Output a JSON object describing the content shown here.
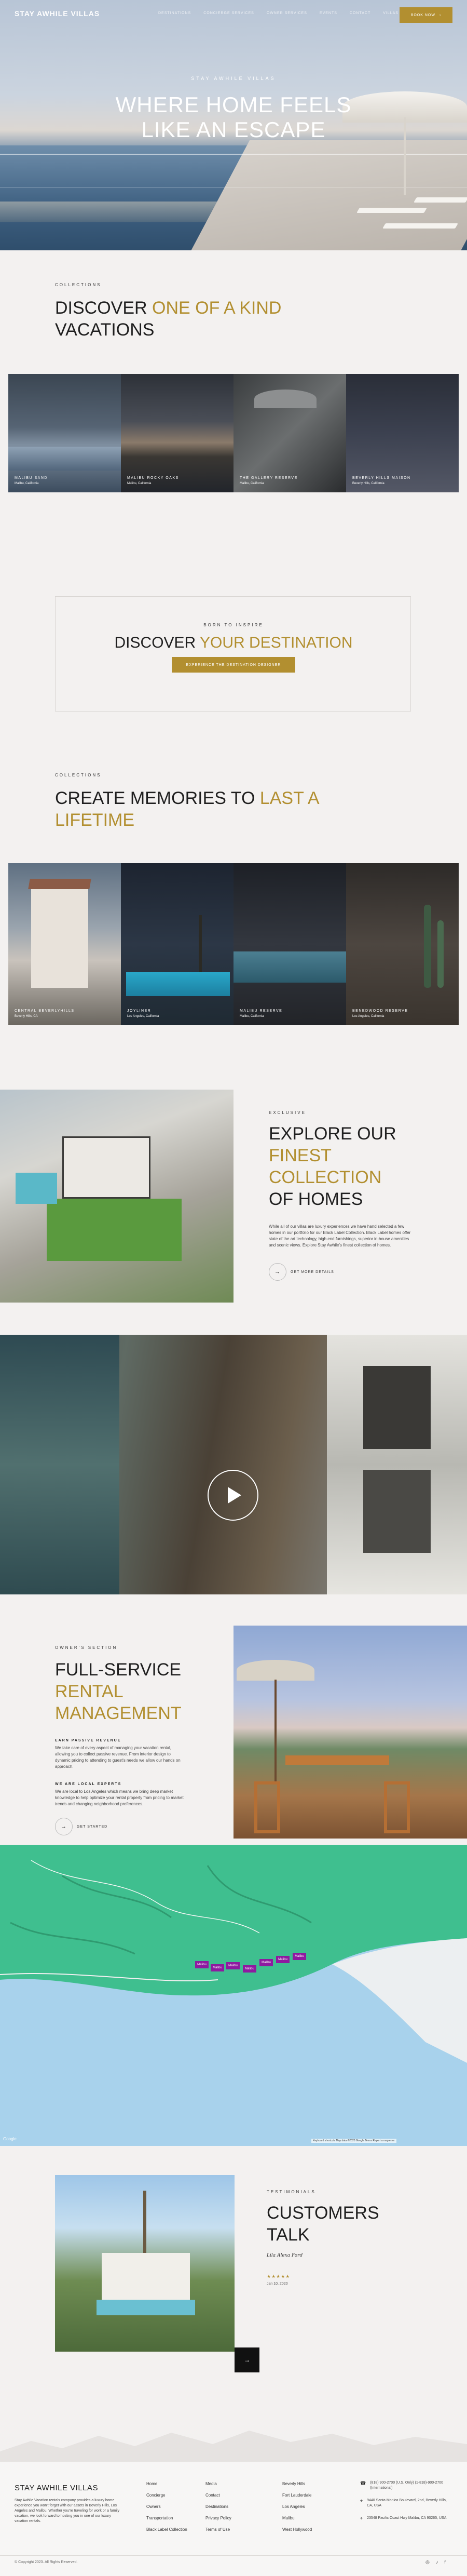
{
  "header": {
    "logo": "STAY AWHILE VILLAS",
    "nav": [
      "DESTINATIONS",
      "CONCIERGE SERVICES",
      "OWNER SERVICES",
      "EVENTS",
      "CONTACT",
      "VILLAS"
    ],
    "book_label": "BOOK NOW",
    "book_icon": "chevron-right-icon"
  },
  "hero": {
    "eyebrow": "STAY AWHILE VILLAS",
    "title_line1": "WHERE HOME FEELS",
    "title_line2": "LIKE AN ESCAPE"
  },
  "collections1": {
    "eyebrow": "COLLECTIONS",
    "title_plain1": "DISCOVER ",
    "title_gold": "ONE OF A KIND",
    "title_plain2": "VACATIONS",
    "cards": [
      {
        "name": "MALIBU SAND",
        "location": "Malibu, California"
      },
      {
        "name": "MALIBU ROCKY OAKS",
        "location": "Malibu, California"
      },
      {
        "name": "THE GALLERY RESERVE",
        "location": "Malibu, California"
      },
      {
        "name": "BEVERLY HILLS MAISON",
        "location": "Beverly Hills, California"
      }
    ]
  },
  "destination": {
    "eyebrow": "BORN TO INSPIRE",
    "title_plain": "DISCOVER ",
    "title_gold": "YOUR DESTINATION",
    "button": "EXPERIENCE THE DESTINATION DESIGNER"
  },
  "collections2": {
    "eyebrow": "COLLECTIONS",
    "title_plain": "CREATE MEMORIES TO ",
    "title_gold1": "LAST A",
    "title_gold2": "LIFETIME",
    "cards": [
      {
        "name": "CENTRAL BEVERLYHILLS",
        "location": "Beverly Hills, CA"
      },
      {
        "name": "JOYLINER",
        "location": "Los Angeles, California"
      },
      {
        "name": "MALIBU RESERVE",
        "location": "Malibu, California"
      },
      {
        "name": "BENEDWOOD RESERVE",
        "location": "Los Angeles, California"
      }
    ]
  },
  "exclusive": {
    "eyebrow": "EXCLUSIVE",
    "title_plain1": "EXPLORE OUR",
    "title_gold1": "FINEST",
    "title_gold2": "COLLECTION",
    "title_plain2": "OF HOMES",
    "body": "While all of our villas are luxury experiences we have hand selected a few homes in our portfolio for our Black Label Collection. Black Label homes offer state of the art technology, high end furnishings, superior in-house amenities and scenic views. Explore Stay Awhile's finest collection of homes.",
    "button": "GET MORE DETAILS",
    "button_icon": "arrow-right-icon"
  },
  "video": {
    "play_icon": "play-icon"
  },
  "owners": {
    "eyebrow": "OWNER'S SECTION",
    "title_plain": "FULL-SERVICE",
    "title_gold1": "RENTAL",
    "title_gold2": "MANAGEMENT",
    "points": [
      {
        "heading": "EARN PASSIVE REVENUE",
        "body": "We take care of every aspect of managing your vacation rental, allowing you to collect passive revenue. From interior design to dynamic pricing to attending to guest's needs we allow our hands on approach."
      },
      {
        "heading": "WE ARE LOCAL EXPERTS",
        "body": "We are local to Los Angeles which means we bring deep market knowledge to help optimize your rental property from pricing to market trends and changing neighborhood preferences."
      }
    ],
    "button": "GET STARTED",
    "button_icon": "arrow-right-icon"
  },
  "map": {
    "pins": [
      "Malibu",
      "Malibu",
      "Malibu",
      "Malibu",
      "Malibu",
      "Malibu",
      "Malibu"
    ],
    "attribution": "Keyboard shortcuts  Map data ©2023 Google  Terms  Report a map error",
    "google_label": "Google"
  },
  "testimonials": {
    "eyebrow": "TESTIMONIALS",
    "title1": "CUSTOMERS",
    "title2": "TALK",
    "signature": "Lila Alexa Ford",
    "stars": "★★★★★",
    "date": "Jan 10, 2020",
    "next_icon": "arrow-right-icon"
  },
  "footer": {
    "logo": "STAY AWHILE VILLAS",
    "about": "Stay Awhile Vacation rentals company provides a luxury home experience you won't forget with our assets in Beverly Hills, Los Angeles and Malibu. Whether you're traveling for work or a family vacation, we look forward to hosting you in one of our luxury vacation rentals.",
    "col1": [
      "Home",
      "Concierge",
      "Owners",
      "Transportation",
      "Black Label Collection"
    ],
    "col2": [
      "Media",
      "Contact",
      "Destinations",
      "Privacy Policy",
      "Terms of Use"
    ],
    "col3": [
      "Beverly Hills",
      "Fort Lauderdale",
      "Los Angeles",
      "Malibu",
      "West Hollywood"
    ],
    "contact": [
      {
        "icon": "phone-icon",
        "text": "(818) 900-2700 (U.S. Only) (1-818)-900-2700 (International)"
      },
      {
        "icon": "location-pin-icon",
        "text": "9440 Santa Monica Boulevard, 2nd, Beverly Hills, CA, USA"
      },
      {
        "icon": "location-pin-icon",
        "text": "23548 Pacific Coast Hwy Malibu, CA 90265, USA"
      }
    ],
    "copyright": "© Copyright 2023. All Rights Reserved.",
    "social": [
      "instagram-icon",
      "tiktok-icon",
      "facebook-icon"
    ]
  },
  "colors": {
    "gold": "#b28f30",
    "bg": "#f3f1f0",
    "map_green": "#3fbf8f",
    "map_sea": "#a8d2ec",
    "pin_purple": "#8e1aa0"
  }
}
